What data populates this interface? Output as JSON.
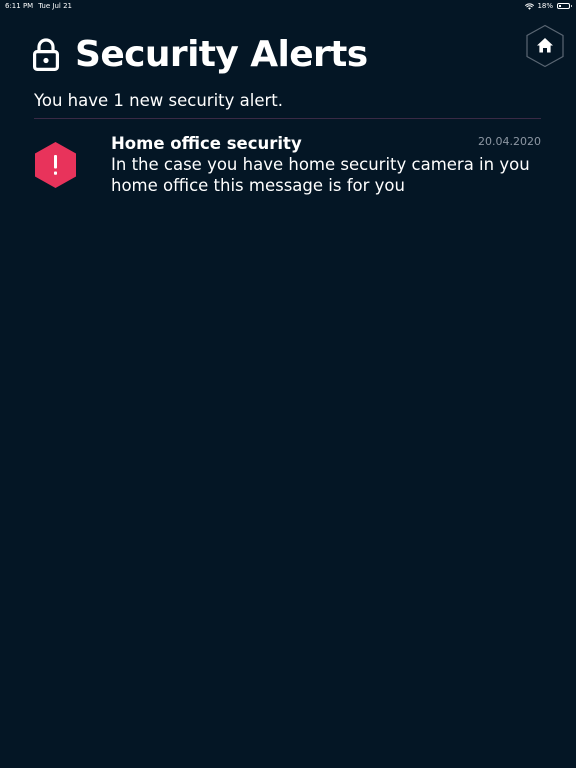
{
  "status_bar": {
    "time": "6:11 PM",
    "date": "Tue Jul 21",
    "battery_text": "18%",
    "battery_level": 0.18
  },
  "header": {
    "title": "Security Alerts",
    "lock_icon": "lock-icon",
    "home_icon": "home-icon"
  },
  "summary": "You have 1 new security alert.",
  "alerts": [
    {
      "title": "Home office security",
      "date": "20.04.2020",
      "message": "In the case you have home security camera in you home office this message is for you",
      "icon": "exclamation-hexagon-icon"
    }
  ],
  "colors": {
    "background": "#041625",
    "alert_accent": "#e8335b",
    "divider": "#3a2a45",
    "muted_text": "#8d97a3"
  }
}
